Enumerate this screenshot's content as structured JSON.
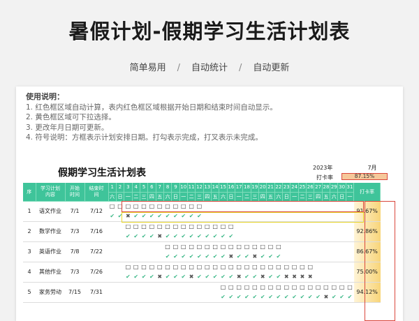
{
  "title": "暑假计划-假期学习生活计划表",
  "subtitle": {
    "items": [
      "简单易用",
      "自动统计",
      "自动更新"
    ],
    "separator": "/"
  },
  "instructions": {
    "heading": "使用说明：",
    "lines": [
      "1. 红色框区域自动计算，表内红色框区域根据开始日期和结束时间自动显示。",
      "2. 黄色框区域可下拉选择。",
      "3. 更改年月日期可更新。",
      "4. 符号说明：方框表示计划安排日期。打勾表示完成，打叉表示未完成。"
    ]
  },
  "plan": {
    "title": "假期学习生活计划表",
    "year": "2023年",
    "month": "7月",
    "rate_label": "打卡率",
    "rate_value": "87.15%",
    "headers": {
      "seq": "序",
      "content": "学习计划内容",
      "start": "开始时间",
      "end": "结束时间",
      "rate": "打卡率"
    },
    "days": [
      "1",
      "2",
      "3",
      "4",
      "5",
      "6",
      "7",
      "8",
      "9",
      "10",
      "11",
      "12",
      "13",
      "14",
      "15",
      "16",
      "17",
      "18",
      "19",
      "20",
      "21",
      "22",
      "23",
      "24",
      "25",
      "26",
      "27",
      "28",
      "29",
      "30",
      "31"
    ],
    "weekdays": [
      "六",
      "日",
      "一",
      "二",
      "三",
      "四",
      "五",
      "六",
      "日",
      "一",
      "二",
      "三",
      "四",
      "五",
      "六",
      "日",
      "一",
      "二",
      "三",
      "四",
      "五",
      "六",
      "日",
      "一",
      "二",
      "三",
      "四",
      "五",
      "六",
      "日",
      "一"
    ],
    "rows": [
      {
        "seq": "1",
        "name": "语文作业",
        "start": "7/1",
        "end": "7/12",
        "rate": "91.67%",
        "marks_top": "BBBBBBBBBBBB...................",
        "marks_bot": "CCXCCCCCCCCC..................."
      },
      {
        "seq": "2",
        "name": "数学作业",
        "start": "7/3",
        "end": "7/16",
        "rate": "92.86%",
        "marks_top": "..BBBBBBBBBBBBBB...............",
        "marks_bot": "..CCCCXCCCCCCCCC..............."
      },
      {
        "seq": "3",
        "name": "英语作业",
        "start": "7/8",
        "end": "7/22",
        "rate": "86.67%",
        "marks_top": ".......BBBBBBBBBBBBBBB.........",
        "marks_bot": ".......CCCCCCCCXCCXCCC........."
      },
      {
        "seq": "4",
        "name": "其他作业",
        "start": "7/3",
        "end": "7/26",
        "rate": "75.00%",
        "marks_top": "..BBBBBBBBBBBBBBBBBBBBBBBB.....",
        "marks_bot": "..CCCCXCCCXCCCCCXCCXCCXXXX....."
      },
      {
        "seq": "5",
        "name": "家务劳动",
        "start": "7/15",
        "end": "7/31",
        "rate": "94.12%",
        "marks_top": "..............BBBBBBBBBBBBBBBBB",
        "marks_bot": "..............CCCCCCCCCCCCCXCCC"
      }
    ]
  },
  "symbols": {
    "box": "□",
    "check": "✔",
    "cross": "✖"
  },
  "colors": {
    "header_green": "#3fc49a",
    "check_green": "#3fb98a",
    "red_frame": "#d9463b",
    "yellow_frame": "#e8d62a",
    "rate_fill": "#f8d57a"
  }
}
